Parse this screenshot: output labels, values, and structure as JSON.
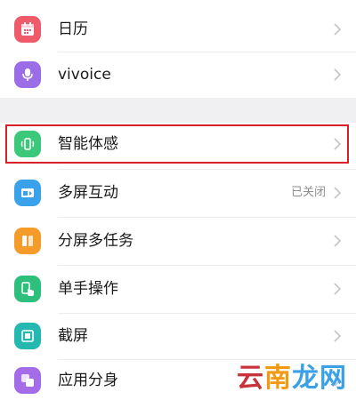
{
  "settings_list": {
    "group1": [
      {
        "label": "日历",
        "icon": "calendar-icon",
        "color": "#ef5b6b"
      },
      {
        "label": "vivoice",
        "icon": "microphone-icon",
        "color": "#9b6ee8"
      }
    ],
    "group2": [
      {
        "label": "智能体感",
        "icon": "phone-motion-icon",
        "color": "#3cc87a"
      },
      {
        "label": "多屏互动",
        "icon": "screen-cast-icon",
        "color": "#3aa2ea",
        "status": "已关闭"
      },
      {
        "label": "分屏多任务",
        "icon": "split-screen-icon",
        "color": "#f59b2a"
      },
      {
        "label": "单手操作",
        "icon": "one-hand-icon",
        "color": "#2fbf7c"
      },
      {
        "label": "截屏",
        "icon": "screenshot-icon",
        "color": "#24b8b0"
      },
      {
        "label": "应用分身",
        "icon": "app-clone-icon",
        "color": "#a46ce8"
      }
    ]
  },
  "watermark": {
    "part1": "云",
    "part2": "南",
    "part3": "龙网"
  }
}
